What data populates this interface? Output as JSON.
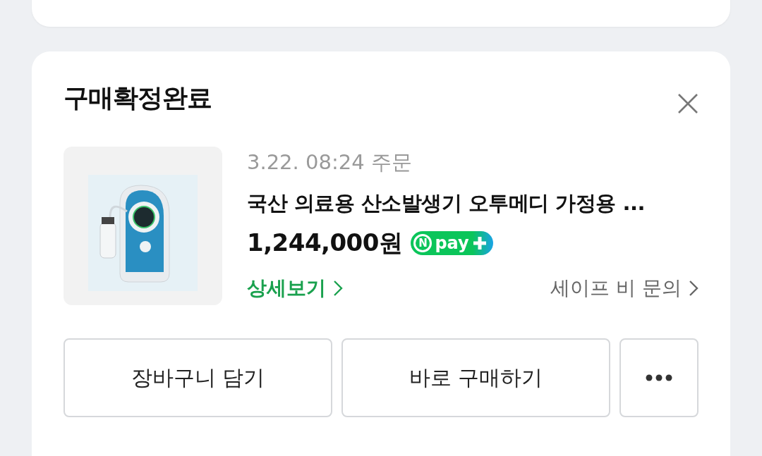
{
  "card": {
    "title": "구매확정완료"
  },
  "order": {
    "date": "3.22. 08:24 주문",
    "product_name": "국산 의료용 산소발생기 오투메디 가정용 ...",
    "price": "1,244,000원",
    "pay_badge": {
      "letter": "N",
      "text": "pay"
    },
    "detail_link": "상세보기",
    "inquiry_link": "세이프 비 문의"
  },
  "buttons": [
    {
      "kind": "text",
      "label": "장바구니 담기"
    },
    {
      "kind": "text",
      "label": "바로 구매하기"
    },
    {
      "kind": "more"
    }
  ]
}
